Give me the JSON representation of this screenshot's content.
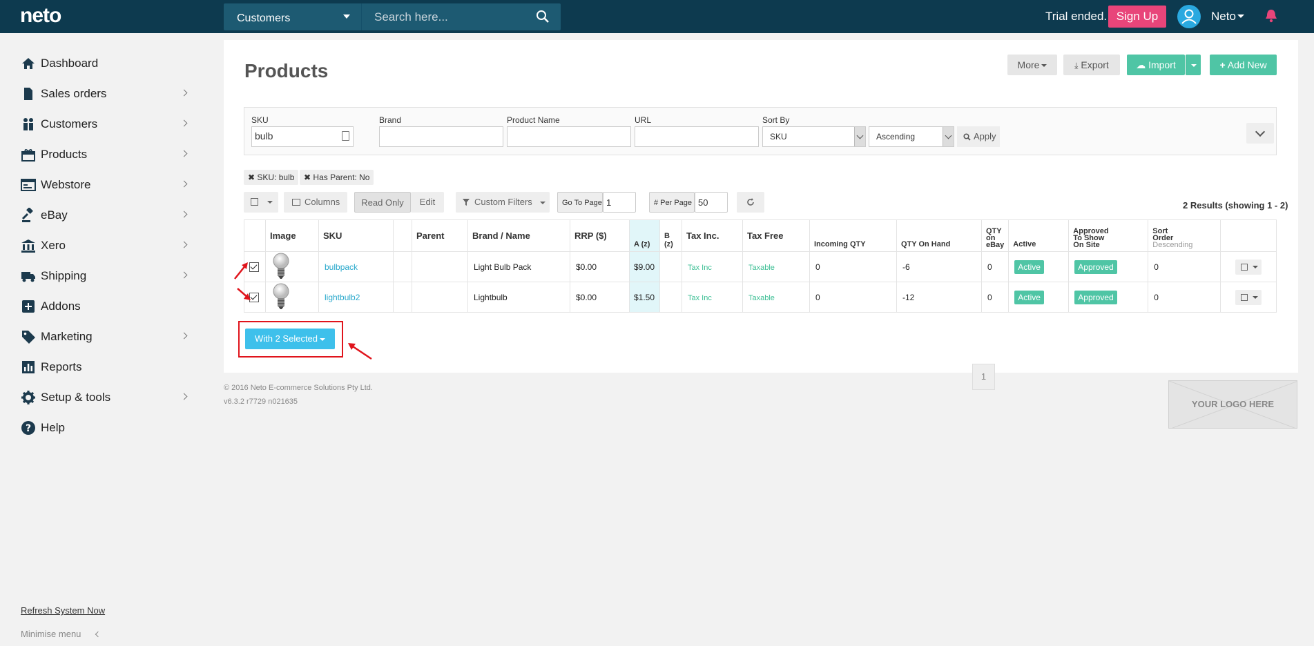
{
  "topbar": {
    "logo": "neto",
    "search_scope": "Customers",
    "search_placeholder": "Search here...",
    "trial": "Trial ended.",
    "signup": "Sign Up",
    "user": "Neto"
  },
  "sidebar": {
    "items": [
      {
        "label": "Dashboard",
        "icon": "home-icon",
        "chevron": false
      },
      {
        "label": "Sales orders",
        "icon": "document-icon",
        "chevron": true
      },
      {
        "label": "Customers",
        "icon": "people-icon",
        "chevron": true
      },
      {
        "label": "Products",
        "icon": "gift-icon",
        "chevron": true
      },
      {
        "label": "Webstore",
        "icon": "browser-icon",
        "chevron": true
      },
      {
        "label": "eBay",
        "icon": "gavel-icon",
        "chevron": true
      },
      {
        "label": "Xero",
        "icon": "bank-icon",
        "chevron": true
      },
      {
        "label": "Shipping",
        "icon": "truck-icon",
        "chevron": true
      },
      {
        "label": "Addons",
        "icon": "plus-square-icon",
        "chevron": false
      },
      {
        "label": "Marketing",
        "icon": "tag-icon",
        "chevron": true
      },
      {
        "label": "Reports",
        "icon": "bar-chart-icon",
        "chevron": false
      },
      {
        "label": "Setup & tools",
        "icon": "gear-icon",
        "chevron": true
      },
      {
        "label": "Help",
        "icon": "question-icon",
        "chevron": false
      }
    ],
    "refresh": "Refresh System Now",
    "minimise": "Minimise menu"
  },
  "page": {
    "title": "Products",
    "more": "More",
    "export": "Export",
    "import": "Import",
    "add_new": "Add New"
  },
  "filters": {
    "sku_label": "SKU",
    "sku_value": "bulb",
    "brand_label": "Brand",
    "name_label": "Product Name",
    "url_label": "URL",
    "sort_label": "Sort By",
    "sort_value": "SKU",
    "order_value": "Ascending",
    "apply": "Apply"
  },
  "tags": [
    "SKU: bulb",
    "Has Parent: No"
  ],
  "toolbar": {
    "columns": "Columns",
    "read_only": "Read Only",
    "edit": "Edit",
    "custom_filters": "Custom Filters",
    "go_to_page": "Go To Page",
    "page_value": "1",
    "per_page": "# Per Page",
    "per_page_value": "50",
    "results": "2 Results (showing 1 - 2)"
  },
  "table": {
    "headers": {
      "image": "Image",
      "sku": "SKU",
      "parent": "Parent",
      "brand_name": "Brand / Name",
      "rrp": "RRP ($)",
      "a": "A (z)",
      "b1": "B",
      "b2": "(z)",
      "tax_inc": "Tax Inc.",
      "tax_free": "Tax Free",
      "incoming": "Incoming QTY",
      "on_hand": "QTY On Hand",
      "ebay1": "QTY",
      "ebay2": "on",
      "ebay3": "eBay",
      "active": "Active",
      "approved1": "Approved",
      "approved2": "To Show",
      "approved3": "On Site",
      "sort1": "Sort",
      "sort2": "Order",
      "sort3": "Descending"
    },
    "rows": [
      {
        "sku": "bulbpack",
        "name": "Light Bulb Pack",
        "rrp": "$0.00",
        "a": "$9.00",
        "tax_inc": "Tax Inc",
        "tax_free": "Taxable",
        "incoming": "0",
        "on_hand": "-6",
        "ebay": "0",
        "active": "Active",
        "approved": "Approved",
        "sort": "0"
      },
      {
        "sku": "lightbulb2",
        "name": "Lightbulb",
        "rrp": "$0.00",
        "a": "$1.50",
        "tax_inc": "Tax Inc",
        "tax_free": "Taxable",
        "incoming": "0",
        "on_hand": "-12",
        "ebay": "0",
        "active": "Active",
        "approved": "Approved",
        "sort": "0"
      }
    ]
  },
  "with_selected": "With 2 Selected",
  "pagination": "1",
  "footer": {
    "copyright": "© 2016 Neto E-commerce Solutions Pty Ltd.",
    "version": "v6.3.2 r7729 n021635",
    "logo_placeholder": "YOUR LOGO HERE"
  },
  "colors": {
    "topbar": "#0d3a4f",
    "accent_green": "#4fc5a5",
    "accent_blue": "#3ec0eb",
    "signup": "#e8457a",
    "annotation_red": "#e0141c"
  }
}
